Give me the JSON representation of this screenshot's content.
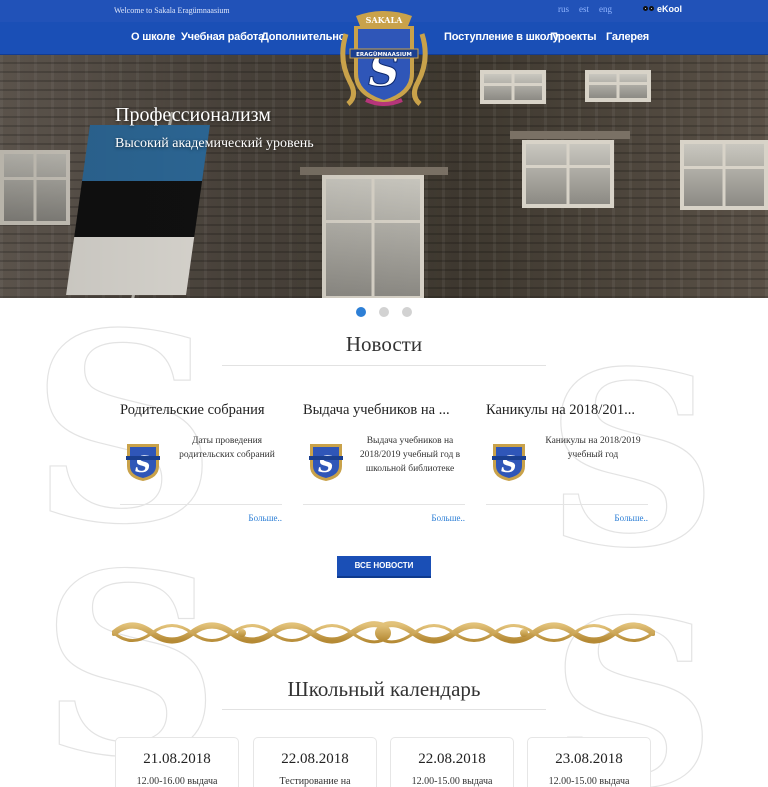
{
  "topbar": {
    "welcome": "Welcome to Sakala Eragümnaasium",
    "languages": [
      "rus",
      "est",
      "eng"
    ],
    "ekool": "eKool"
  },
  "nav": {
    "left": [
      "О школе",
      "Учебная работа",
      "Дополнительно"
    ],
    "right": [
      "Поступление в школу",
      "Проекты",
      "Галерея"
    ]
  },
  "crest": {
    "top_text": "SAKALA",
    "band_text": "ERAGÜMNAASIUM",
    "letter": "S"
  },
  "hero": {
    "title": "Профессионализм",
    "subtitle": "Высокий академический уровень",
    "slides": 3,
    "active_slide": 1
  },
  "news": {
    "heading": "Новости",
    "items": [
      {
        "title": "Родительские собрания",
        "text": "Даты проведения родительских собраний",
        "more": "Больше.."
      },
      {
        "title": "Выдача учебников на ...",
        "text": "Выдача учебников на 2018/2019 учебный год в школьной библиотеке",
        "more": "Больше.."
      },
      {
        "title": "Каникулы на 2018/201...",
        "text": "Каникулы на 2018/2019 учебный год",
        "more": "Больше.."
      }
    ],
    "all_button": "ВСЕ НОВОСТИ"
  },
  "calendar": {
    "heading": "Школьный календарь",
    "items": [
      {
        "date": "21.08.2018",
        "text": "12.00-16.00 выдача"
      },
      {
        "date": "22.08.2018",
        "text": "Тестирование на"
      },
      {
        "date": "22.08.2018",
        "text": "12.00-15.00 выдача"
      },
      {
        "date": "23.08.2018",
        "text": "12.00-15.00 выдача"
      }
    ]
  },
  "colors": {
    "nav_blue": "#1a4fb6",
    "topbar_blue": "#2152b8",
    "link_blue": "#2d7fd6",
    "gold": "#c9a24a"
  }
}
